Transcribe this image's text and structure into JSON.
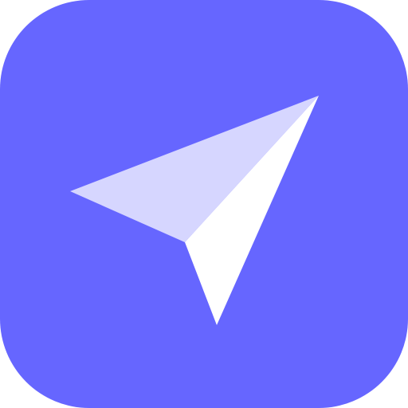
{
  "icon": {
    "name": "paper-plane-icon",
    "colors": {
      "background": "#6666ff",
      "plane_light": "#d6d6ff",
      "plane_white": "#ffffff"
    }
  }
}
